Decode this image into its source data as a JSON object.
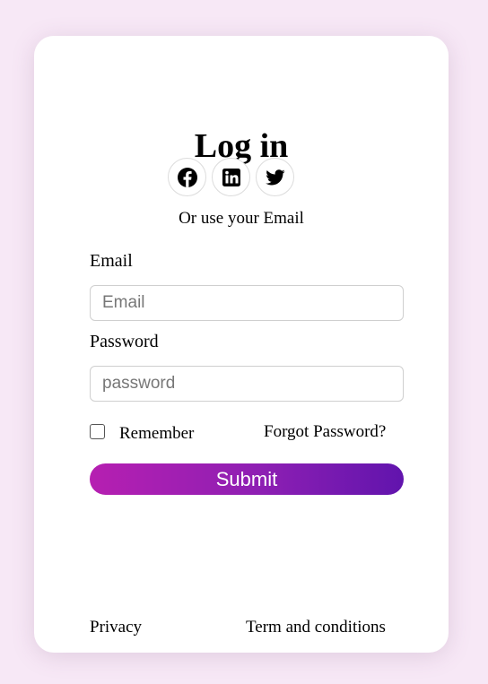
{
  "page": {
    "title": "Log in"
  },
  "social": {
    "buttons": [
      {
        "name": "facebook",
        "icon": "facebook-icon"
      },
      {
        "name": "linkedin",
        "icon": "linkedin-icon"
      },
      {
        "name": "twitter",
        "icon": "twitter-icon"
      }
    ],
    "or_text": "Or use your Email"
  },
  "form": {
    "email_label": "Email",
    "email_placeholder": "Email",
    "email_value": "",
    "password_label": "Password",
    "password_placeholder": "password",
    "password_value": "",
    "remember_label": "Remember",
    "remember_checked": false,
    "forgot_label": "Forgot Password?",
    "submit_label": "Submit"
  },
  "footer": {
    "privacy_label": "Privacy",
    "terms_label": "Term and conditions"
  },
  "colors": {
    "background": "#f7e8f6",
    "card": "#ffffff",
    "submit_gradient_start": "#b61fb1",
    "submit_gradient_end": "#6114ad"
  }
}
